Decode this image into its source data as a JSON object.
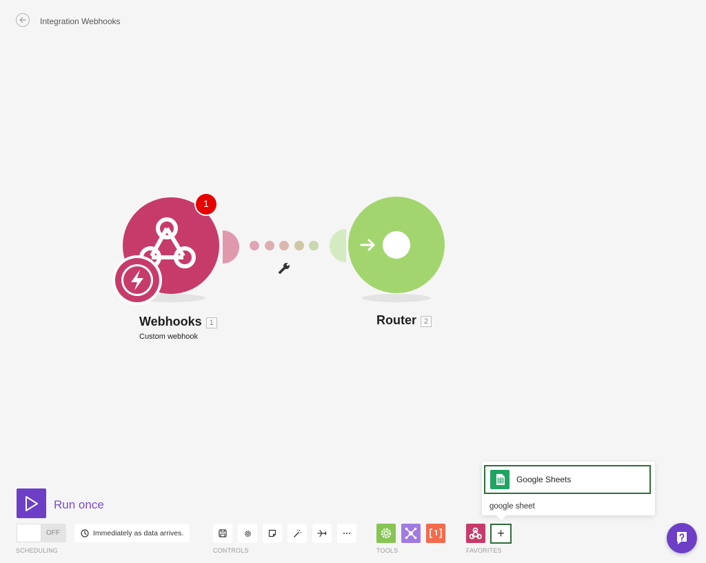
{
  "header": {
    "title": "Integration Webhooks"
  },
  "modules": [
    {
      "name": "Webhooks",
      "id": "1",
      "subtitle": "Custom webhook",
      "badge": "1"
    },
    {
      "name": "Router",
      "id": "2"
    }
  ],
  "run": {
    "label": "Run once"
  },
  "scheduling": {
    "toggle_state": "OFF",
    "info": "Immediately as data arrives.",
    "section_label": "SCHEDULING"
  },
  "controls": {
    "section_label": "CONTROLS"
  },
  "tools": {
    "section_label": "TOOLS"
  },
  "favorites": {
    "section_label": "FAVORITES",
    "add_label": "+"
  },
  "popup": {
    "item_label": "Google Sheets",
    "search_text": "google sheet"
  },
  "colors": {
    "webhook": "#c73b6a",
    "router": "#a3d56f",
    "accent": "#6d3fc7",
    "badge": "#e80000",
    "tools_settings": "#86c552",
    "tools_flow": "#a17bdf",
    "tools_text": "#f26b4c"
  },
  "icons": {
    "back": "arrow-left-icon",
    "webhook": "webhook-icon",
    "trigger": "lightning-icon",
    "router": "arrow-right-icon",
    "wrench": "wrench-icon",
    "clock": "clock-icon",
    "save": "save-icon",
    "settings": "gear-icon",
    "notes": "note-icon",
    "autoalign": "magic-wand-icon",
    "explain": "airplane-icon",
    "more": "more-icon",
    "google_sheets": "google-sheets-icon",
    "help": "help-icon"
  }
}
